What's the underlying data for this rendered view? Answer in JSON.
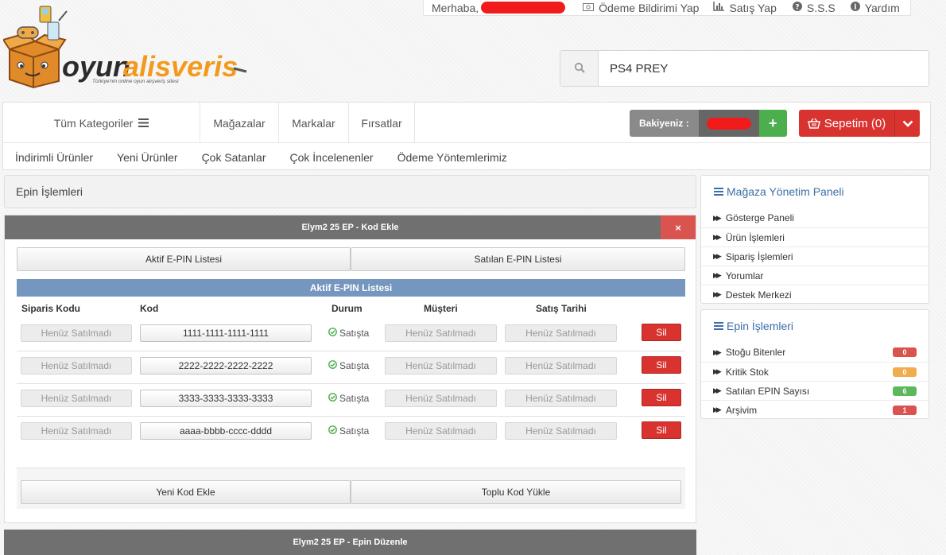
{
  "topbar": {
    "greeting": "Merhaba,",
    "links": [
      {
        "icon": "money-icon",
        "label": "Ödeme Bildirimi Yap"
      },
      {
        "icon": "bar-chart-icon",
        "label": "Satış Yap"
      },
      {
        "icon": "question-icon",
        "label": "S.S.S"
      },
      {
        "icon": "info-icon",
        "label": "Yardım"
      }
    ]
  },
  "logo": {
    "brand_dark": "oyun",
    "brand_accent": "alisveris",
    "tagline": "Türkiye'nin online oyun alışveriş sitesi",
    "colors": {
      "dark": "#2b2b2b",
      "accent": "#f39a1e"
    }
  },
  "search": {
    "value": "PS4 PREY",
    "icon": "search-icon"
  },
  "nav": {
    "all_categories": "Tüm Kategoriler",
    "links": [
      "Mağazalar",
      "Markalar",
      "Fırsatlar"
    ],
    "secondary": [
      "İndirimli Ürünler",
      "Yeni Ürünler",
      "Çok Satanlar",
      "Çok İncelenenler",
      "Ödeme Yöntemlerimiz"
    ],
    "balance_label": "Bakiyeniz :",
    "add_balance": "+",
    "cart_label": "Sepetim (0)"
  },
  "page": {
    "title": "Epin İşlemleri"
  },
  "panel": {
    "title": "Elym2 25 EP - Kod Ekle",
    "close": "×",
    "tabs": [
      "Aktif E-PIN Listesi",
      "Satılan E-PIN Listesi"
    ],
    "list_title": "Aktif E-PIN Listesi",
    "columns": [
      "Siparis Kodu",
      "Kod",
      "Durum",
      "Müşteri",
      "Satış Tarihi"
    ],
    "rows": [
      {
        "order": "Henüz Satılmadı",
        "code": "1111-1111-1111-1111",
        "status": "Satışta",
        "customer": "Henüz Satılmadı",
        "date": "Henüz Satılmadı",
        "action": "Sil"
      },
      {
        "order": "Henüz Satılmadı",
        "code": "2222-2222-2222-2222",
        "status": "Satışta",
        "customer": "Henüz Satılmadı",
        "date": "Henüz Satılmadı",
        "action": "Sil"
      },
      {
        "order": "Henüz Satılmadı",
        "code": "3333-3333-3333-3333",
        "status": "Satışta",
        "customer": "Henüz Satılmadı",
        "date": "Henüz Satılmadı",
        "action": "Sil"
      },
      {
        "order": "Henüz Satılmadı",
        "code": "aaaa-bbbb-cccc-dddd",
        "status": "Satışta",
        "customer": "Henüz Satılmadı",
        "date": "Henüz Satılmadı",
        "action": "Sil"
      }
    ],
    "footer_buttons": [
      "Yeni Kod Ekle",
      "Toplu Kod Yükle"
    ]
  },
  "panel2": {
    "title": "Elym2 25 EP - Epin Düzenle"
  },
  "sidebar": {
    "store_panel": {
      "title": "Mağaza Yönetim Paneli",
      "items": [
        "Gösterge Paneli",
        "Ürün İşlemleri",
        "Sipariş İşlemleri",
        "Yorumlar",
        "Destek Merkezi"
      ]
    },
    "epin_panel": {
      "title": "Epin İşlemleri",
      "items": [
        {
          "label": "Stoğu Bitenler",
          "count": "0",
          "color": "#d9534f"
        },
        {
          "label": "Kritik Stok",
          "count": "0",
          "color": "#f0ad4e"
        },
        {
          "label": "Satılan EPIN Sayısı",
          "count": "6",
          "color": "#5cb85c"
        },
        {
          "label": "Arşivim",
          "count": "1",
          "color": "#d9534f"
        }
      ]
    }
  }
}
